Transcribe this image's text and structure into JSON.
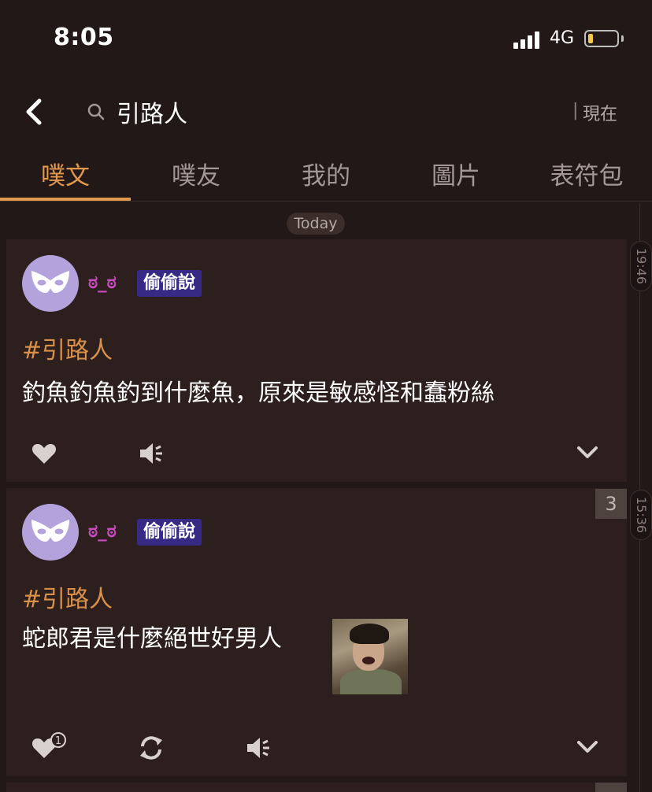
{
  "status_bar": {
    "time": "8:05",
    "network": "4G"
  },
  "header": {
    "search_query": "引路人",
    "separator": "|",
    "sort_label": "現在"
  },
  "tabs": [
    {
      "label": "噗文",
      "active": true
    },
    {
      "label": "噗友",
      "active": false
    },
    {
      "label": "我的",
      "active": false
    },
    {
      "label": "圖片",
      "active": false
    },
    {
      "label": "表符包",
      "active": false
    }
  ],
  "date_label": "Today",
  "posts": [
    {
      "nickname": "ಠ_ಠ",
      "tag": "偷偷說",
      "hashtag": "#引路人",
      "text": "釣魚釣魚釣到什麼魚，原來是敏感怪和蠢粉絲",
      "time": "19:46"
    },
    {
      "nickname": "ಠ_ಠ",
      "tag": "偷偷說",
      "hashtag": "#引路人",
      "text": "蛇郎君是什麼絕世好男人",
      "time": "15:36",
      "response_count": "3",
      "like_count": "1"
    }
  ],
  "colors": {
    "background": "#231818",
    "card": "#2c1f1e",
    "accent": "#e3994d",
    "hashtag": "#d9914a",
    "nickname": "#c94bc0",
    "tag_bg": "#372a85"
  }
}
